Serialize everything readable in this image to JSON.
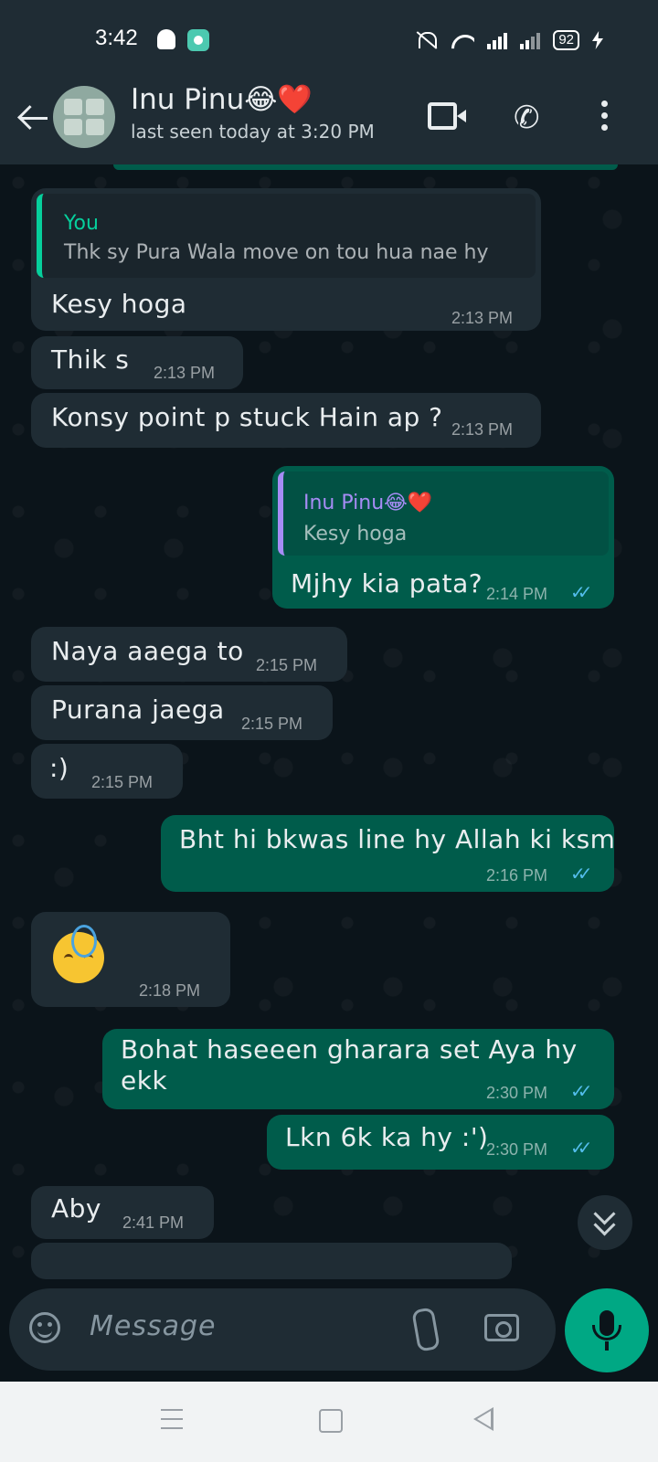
{
  "status_bar": {
    "time": "3:42",
    "battery": "92"
  },
  "header": {
    "name": "Inu Pinu😂❤️",
    "last_seen": "last seen today at 3:20 PM"
  },
  "messages": [
    {
      "dir": "in",
      "quote_author": "You",
      "quote_text": "Thk sy Pura Wala move on tou hua nae hy",
      "text": "Kesy hoga",
      "time": "2:13 PM"
    },
    {
      "dir": "in",
      "text": "Thik s",
      "time": "2:13 PM"
    },
    {
      "dir": "in",
      "text": "Konsy point p stuck Hain ap ?",
      "time": "2:13 PM"
    },
    {
      "dir": "out",
      "quote_author": "Inu Pinu😂❤️",
      "quote_text": "Kesy hoga",
      "text": "Mjhy kia pata?",
      "time": "2:14 PM"
    },
    {
      "dir": "in",
      "text": "Naya aaega to",
      "time": "2:15 PM"
    },
    {
      "dir": "in",
      "text": "Purana jaega",
      "time": "2:15 PM"
    },
    {
      "dir": "in",
      "text": ":)",
      "time": "2:15 PM"
    },
    {
      "dir": "out",
      "text": "Bht hi bkwas line hy Allah ki ksm",
      "time": "2:16 PM"
    },
    {
      "dir": "in",
      "emoji": "face-with-halo-sleepy-emoji",
      "time": "2:18 PM"
    },
    {
      "dir": "out",
      "text_line1": "Bohat haseeen gharara set Aya hy",
      "text_line2": "ekk",
      "time": "2:30 PM"
    },
    {
      "dir": "out",
      "text": "Lkn 6k ka hy :')",
      "time": "2:30 PM"
    },
    {
      "dir": "in",
      "text": "Aby",
      "time": "2:41 PM"
    }
  ],
  "input": {
    "placeholder": "Message"
  },
  "colors": {
    "header_bg": "#1f2c34",
    "chat_bg": "#0b141a",
    "incoming": "#1f2c34",
    "outgoing": "#005c4b",
    "accent": "#00a884",
    "read_ticks": "#53bdeb"
  }
}
